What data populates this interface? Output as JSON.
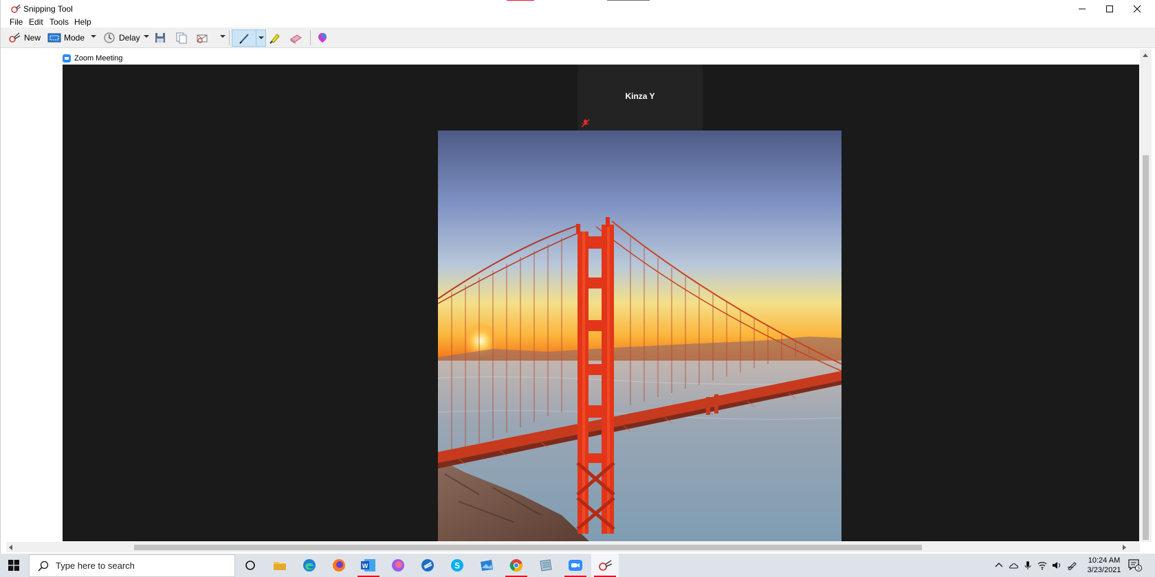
{
  "window": {
    "title": "Snipping Tool",
    "menu": [
      "File",
      "Edit",
      "Tools",
      "Help"
    ]
  },
  "toolbar": {
    "new_label": "New",
    "mode_label": "Mode",
    "delay_label": "Delay"
  },
  "capture": {
    "window_caption": "Zoom Meeting",
    "participant_name": "Kinza Y"
  },
  "taskbar": {
    "search_placeholder": "Type here to search",
    "apps": [
      "cortana-icon",
      "file-explorer-icon",
      "edge-icon",
      "firefox-icon",
      "word-icon",
      "firefox-nightly-icon",
      "edge-beta-icon",
      "skype-icon",
      "photos-icon",
      "chrome-icon",
      "notepad-icon",
      "zoom-icon",
      "snipping-tool-icon"
    ],
    "time": "10:24 AM",
    "date": "3/23/2021",
    "notification_count": "3"
  },
  "colors": {
    "zoom_background": "#1a1a1a",
    "accent_red": "#e81123",
    "zoom_blue": "#2d8cff"
  }
}
